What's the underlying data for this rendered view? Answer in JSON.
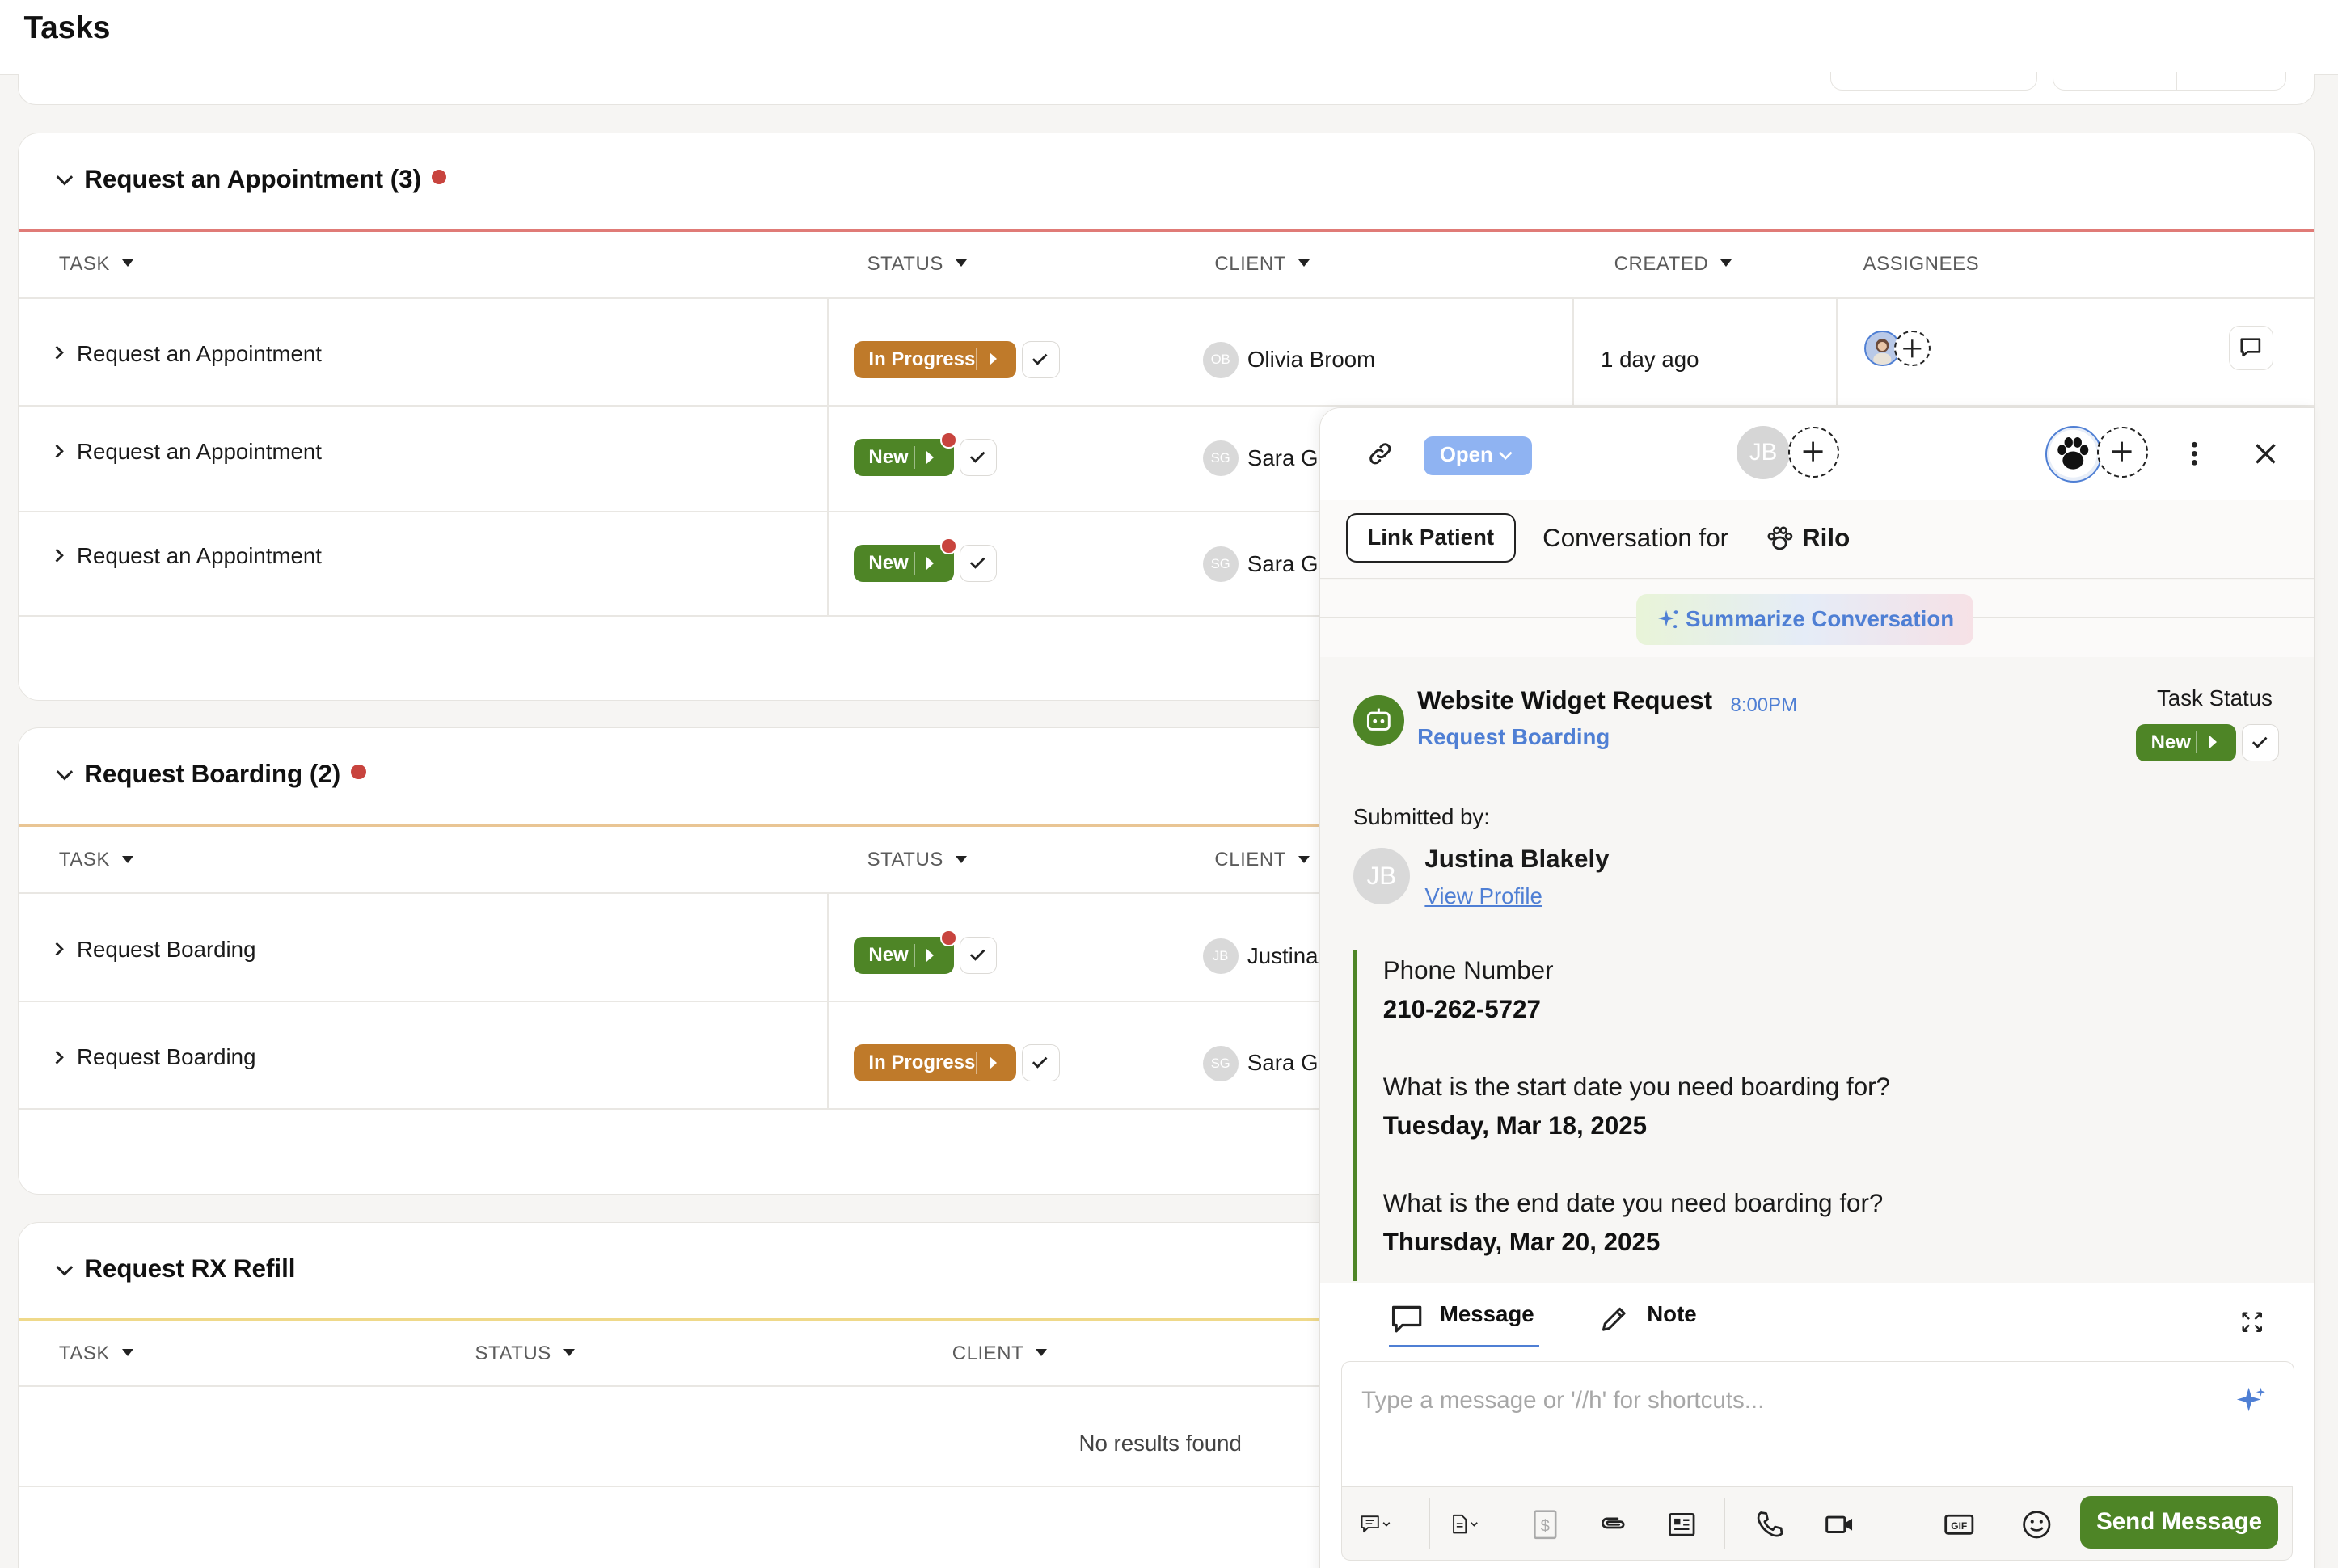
{
  "page": {
    "title": "Tasks"
  },
  "columns": {
    "task": "TASK",
    "status": "STATUS",
    "client": "CLIENT",
    "created": "CREATED",
    "assignees": "ASSIGNEES"
  },
  "sections": [
    {
      "title": "Request an Appointment (3)",
      "accent": "#e07b77",
      "rows": [
        {
          "task": "Request an Appointment",
          "status": "In Progress",
          "client_initials": "OB",
          "client": "Olivia Broom",
          "created": "1 day ago"
        },
        {
          "task": "Request an Appointment",
          "status": "New",
          "client_initials": "SG",
          "client": "Sara Gl"
        },
        {
          "task": "Request an Appointment",
          "status": "New",
          "client_initials": "SG",
          "client": "Sara Gl"
        }
      ]
    },
    {
      "title": "Request Boarding (2)",
      "accent": "#e9c594",
      "rows": [
        {
          "task": "Request Boarding",
          "status": "New",
          "client_initials": "JB",
          "client": "Justina"
        },
        {
          "task": "Request Boarding",
          "status": "In Progress",
          "client_initials": "SG",
          "client": "Sara Gl"
        }
      ]
    },
    {
      "title": "Request RX Refill",
      "accent": "#efd98a",
      "empty_text": "No results found"
    }
  ],
  "panel": {
    "status_label": "Open",
    "assignee_initials": "JB",
    "link_patient": "Link Patient",
    "conversation_for": "Conversation for",
    "patient_name": "Rilo",
    "summarize": "Summarize Conversation",
    "request_title": "Website Widget Request",
    "request_time": "8:00PM",
    "request_type": "Request Boarding",
    "task_status_label": "Task Status",
    "task_status": "New",
    "submitted_by_label": "Submitted by:",
    "submitter_initials": "JB",
    "submitter_name": "Justina Blakely",
    "view_profile": "View Profile",
    "fields": [
      {
        "label": "Phone Number",
        "value": "210-262-5727"
      },
      {
        "label": "What is the start date you need boarding for?",
        "value": "Tuesday, Mar 18, 2025"
      },
      {
        "label": "What is the end date you need boarding for?",
        "value": "Thursday, Mar 20, 2025"
      }
    ],
    "composer": {
      "tab_message": "Message",
      "tab_note": "Note",
      "placeholder": "Type a message or '//h' for shortcuts...",
      "send": "Send Message"
    }
  },
  "colors": {
    "green": "#4e8526",
    "orange": "#bf7a2a",
    "blue": "#4f7fd4",
    "red_dot": "#c8443e"
  }
}
